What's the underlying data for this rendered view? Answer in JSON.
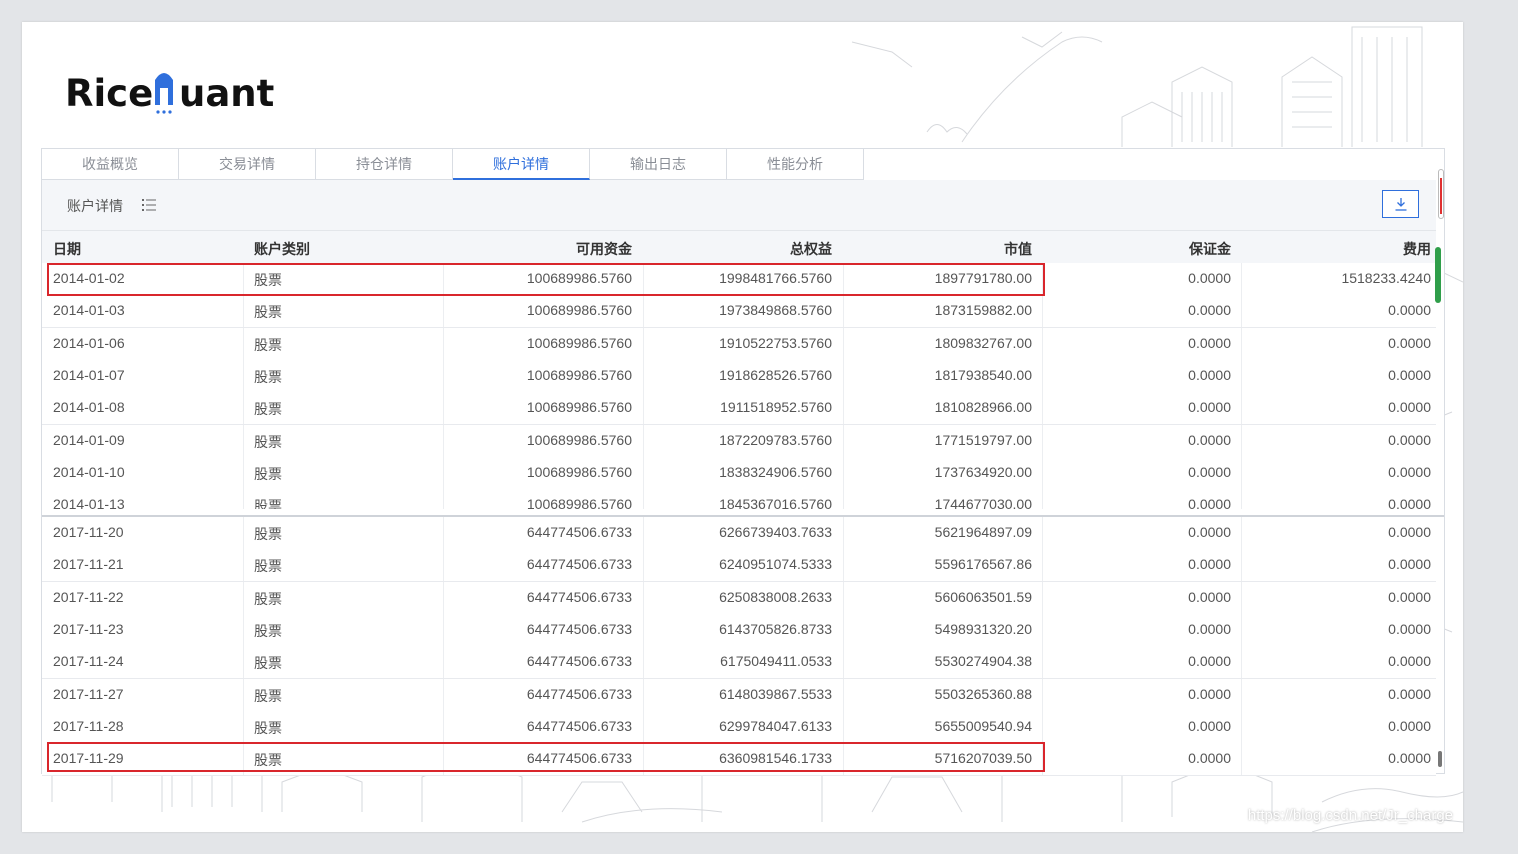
{
  "logo": {
    "text_before": "Rice",
    "text_after": "uant"
  },
  "tabs": [
    {
      "label": "收益概览",
      "active": false
    },
    {
      "label": "交易详情",
      "active": false
    },
    {
      "label": "持仓详情",
      "active": false
    },
    {
      "label": "账户详情",
      "active": true
    },
    {
      "label": "输出日志",
      "active": false
    },
    {
      "label": "性能分析",
      "active": false
    }
  ],
  "toolbar": {
    "title": "账户详情",
    "list_icon": "list-icon",
    "download_icon": "download-icon"
  },
  "columns": {
    "date": "日期",
    "type": "账户类别",
    "cash": "可用资金",
    "total": "总权益",
    "market_value": "市值",
    "margin": "保证金",
    "fee": "费用"
  },
  "rows_top": [
    {
      "date": "2014-01-02",
      "type": "股票",
      "cash": "100689986.5760",
      "total": "1998481766.5760",
      "market_value": "1897791780.00",
      "margin": "0.0000",
      "fee": "1518233.4240"
    },
    {
      "date": "2014-01-03",
      "type": "股票",
      "cash": "100689986.5760",
      "total": "1973849868.5760",
      "market_value": "1873159882.00",
      "margin": "0.0000",
      "fee": "0.0000"
    },
    {
      "date": "2014-01-06",
      "type": "股票",
      "cash": "100689986.5760",
      "total": "1910522753.5760",
      "market_value": "1809832767.00",
      "margin": "0.0000",
      "fee": "0.0000"
    },
    {
      "date": "2014-01-07",
      "type": "股票",
      "cash": "100689986.5760",
      "total": "1918628526.5760",
      "market_value": "1817938540.00",
      "margin": "0.0000",
      "fee": "0.0000"
    },
    {
      "date": "2014-01-08",
      "type": "股票",
      "cash": "100689986.5760",
      "total": "1911518952.5760",
      "market_value": "1810828966.00",
      "margin": "0.0000",
      "fee": "0.0000"
    },
    {
      "date": "2014-01-09",
      "type": "股票",
      "cash": "100689986.5760",
      "total": "1872209783.5760",
      "market_value": "1771519797.00",
      "margin": "0.0000",
      "fee": "0.0000"
    },
    {
      "date": "2014-01-10",
      "type": "股票",
      "cash": "100689986.5760",
      "total": "1838324906.5760",
      "market_value": "1737634920.00",
      "margin": "0.0000",
      "fee": "0.0000"
    },
    {
      "date": "2014-01-13",
      "type": "股票",
      "cash": "100689986.5760",
      "total": "1845367016.5760",
      "market_value": "1744677030.00",
      "margin": "0.0000",
      "fee": "0.0000"
    }
  ],
  "rows_bottom": [
    {
      "date": "2017-11-20",
      "type": "股票",
      "cash": "644774506.6733",
      "total": "6266739403.7633",
      "market_value": "5621964897.09",
      "margin": "0.0000",
      "fee": "0.0000"
    },
    {
      "date": "2017-11-21",
      "type": "股票",
      "cash": "644774506.6733",
      "total": "6240951074.5333",
      "market_value": "5596176567.86",
      "margin": "0.0000",
      "fee": "0.0000"
    },
    {
      "date": "2017-11-22",
      "type": "股票",
      "cash": "644774506.6733",
      "total": "6250838008.2633",
      "market_value": "5606063501.59",
      "margin": "0.0000",
      "fee": "0.0000"
    },
    {
      "date": "2017-11-23",
      "type": "股票",
      "cash": "644774506.6733",
      "total": "6143705826.8733",
      "market_value": "5498931320.20",
      "margin": "0.0000",
      "fee": "0.0000"
    },
    {
      "date": "2017-11-24",
      "type": "股票",
      "cash": "644774506.6733",
      "total": "6175049411.0533",
      "market_value": "5530274904.38",
      "margin": "0.0000",
      "fee": "0.0000"
    },
    {
      "date": "2017-11-27",
      "type": "股票",
      "cash": "644774506.6733",
      "total": "6148039867.5533",
      "market_value": "5503265360.88",
      "margin": "0.0000",
      "fee": "0.0000"
    },
    {
      "date": "2017-11-28",
      "type": "股票",
      "cash": "644774506.6733",
      "total": "6299784047.6133",
      "market_value": "5655009540.94",
      "margin": "0.0000",
      "fee": "0.0000"
    },
    {
      "date": "2017-11-29",
      "type": "股票",
      "cash": "644774506.6733",
      "total": "6360981546.1733",
      "market_value": "5716207039.50",
      "margin": "0.0000",
      "fee": "0.0000"
    }
  ],
  "watermark": "https://blog.csdn.net/Jr_charge",
  "colors": {
    "accent": "#2f6fdc",
    "highlight": "#d9262c",
    "scroll_green": "#2f9e4a"
  }
}
